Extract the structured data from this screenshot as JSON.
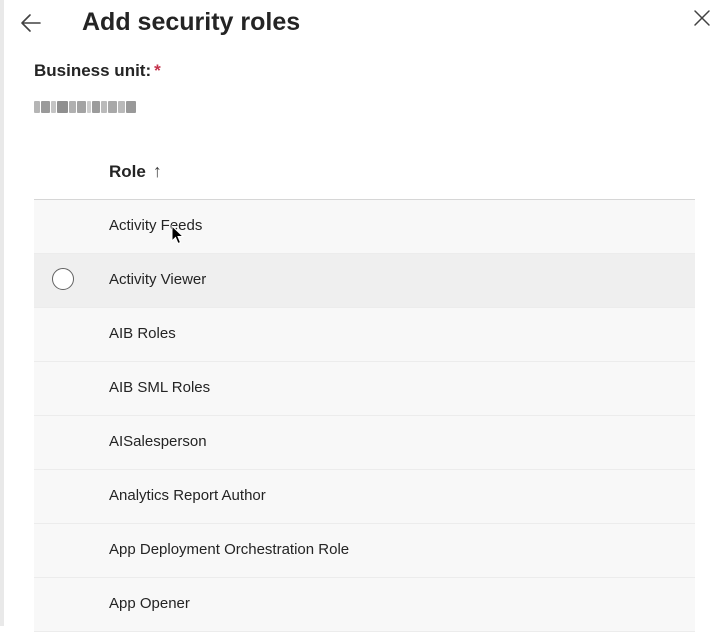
{
  "panel": {
    "title": "Add security roles",
    "back_icon": "arrow-left-icon",
    "close_icon": "close-icon"
  },
  "business_unit": {
    "label": "Business unit:",
    "required_marker": "*",
    "value": "",
    "value_note": "blurred"
  },
  "grid": {
    "column_header": "Role",
    "sort_indicator": "↑",
    "rows": [
      {
        "label": "Activity Feeds"
      },
      {
        "label": "Activity Viewer"
      },
      {
        "label": "AIB Roles"
      },
      {
        "label": "AIB SML Roles"
      },
      {
        "label": "AISalesperson"
      },
      {
        "label": "Analytics Report Author"
      },
      {
        "label": "App Deployment Orchestration Role"
      },
      {
        "label": "App Opener"
      }
    ]
  },
  "colors": {
    "required": "#c4314b",
    "row_background": "#f8f8f8",
    "row_hover": "#efefef",
    "text": "#242424"
  }
}
